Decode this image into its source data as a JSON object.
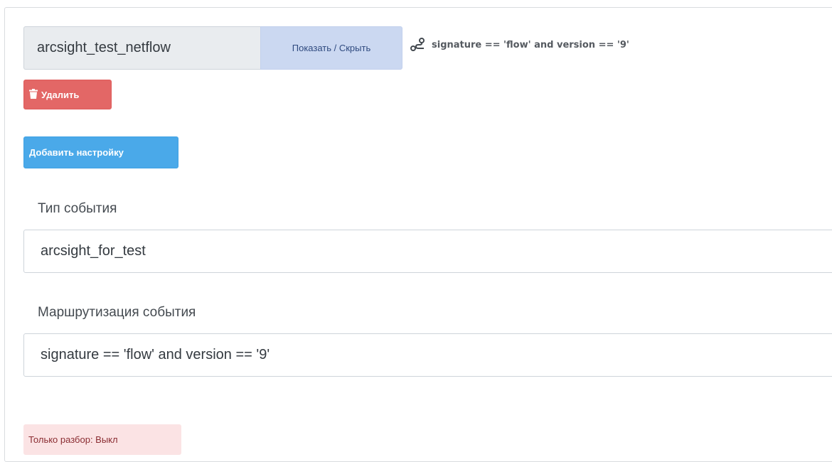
{
  "header": {
    "name_value": "arcsight_test_netflow",
    "toggle_label": "Показать / Скрыть",
    "route_icon": "route-icon",
    "route_summary": "signature == 'flow' and version == '9'"
  },
  "actions": {
    "delete_icon": "trash-icon",
    "delete_label": "Удалить",
    "add_setting_label": "Добавить настройку"
  },
  "form": {
    "event_type_label": "Тип события",
    "event_type_value": "arcsight_for_test",
    "routing_label": "Маршрутизация события",
    "routing_value": "signature == 'flow' and version == '9'"
  },
  "badges": {
    "parse_only": "Только разбор: Выкл"
  },
  "colors": {
    "danger": "#e36766",
    "info": "#4aa9e9",
    "secondary_light": "#cbd8f1",
    "danger_light": "#fbe3e4"
  }
}
